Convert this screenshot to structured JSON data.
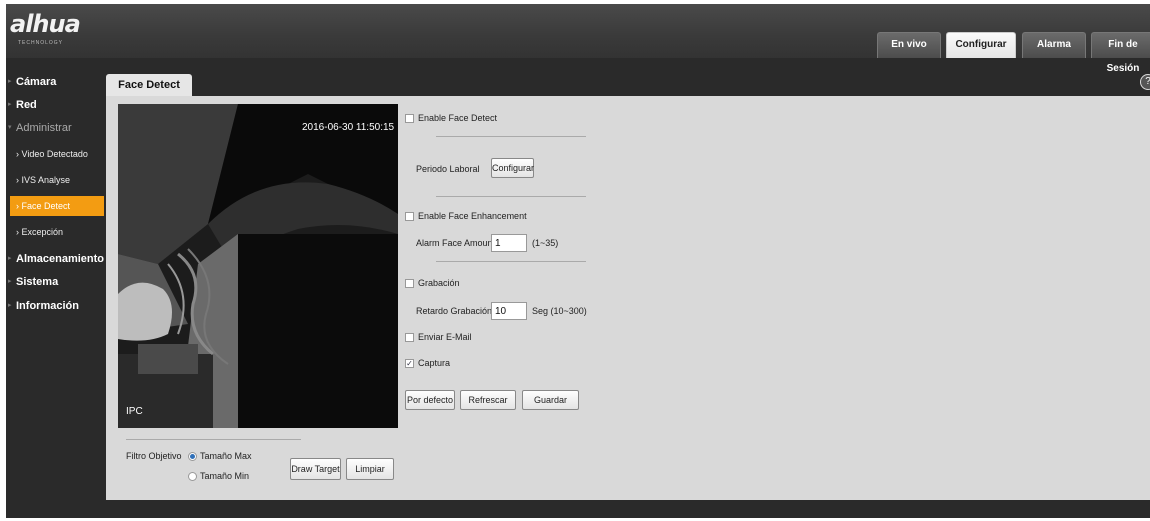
{
  "logo": {
    "text": "alhua",
    "subtext": "TECHNOLOGY"
  },
  "top_tabs": [
    {
      "label": "En vivo"
    },
    {
      "label": "Configurar"
    },
    {
      "label": "Alarma"
    },
    {
      "label": "Fin de Sesión"
    }
  ],
  "sidebar": {
    "camera": "Cámara",
    "network": "Red",
    "admin": "Administrar",
    "video_detect": "Video Detectado",
    "ivs": "IVS Analyse",
    "face_detect": "Face Detect",
    "exception": "Excepción",
    "storage": "Almacenamiento",
    "system": "Sistema",
    "info": "Información"
  },
  "page_tab": "Face Detect",
  "help_glyph": "?",
  "video": {
    "timestamp": "2016-06-30 11:50:15",
    "channel_name": "IPC"
  },
  "settings": {
    "enable_face_detect": {
      "label": "Enable Face Detect",
      "checked": false
    },
    "working_period": {
      "label": "Periodo Laboral",
      "button": "Configurar"
    },
    "enable_face_enhancement": {
      "label": "Enable Face Enhancement",
      "checked": false
    },
    "alarm_face_amount": {
      "label": "Alarm Face Amount",
      "value": "1",
      "range": "(1~35)"
    },
    "recording": {
      "label": "Grabación",
      "checked": false
    },
    "recording_delay": {
      "label": "Retardo Grabación",
      "value": "10",
      "unit": "Seg (10~300)"
    },
    "send_email": {
      "label": "Enviar E-Mail",
      "checked": false
    },
    "snapshot": {
      "label": "Captura",
      "checked": true,
      "glyph": "✓"
    }
  },
  "actions": {
    "default": "Por defecto",
    "refresh": "Refrescar",
    "save": "Guardar"
  },
  "target_filter": {
    "label": "Filtro Objetivo",
    "max_size": "Tamaño Max",
    "min_size": "Tamaño Min",
    "selected": "Tamaño Max",
    "draw_target": "Draw Target",
    "clear": "Limpiar"
  },
  "colors": {
    "accent": "#f39c12",
    "panel": "#d9d9d9",
    "chrome": "#2a2a2a"
  }
}
